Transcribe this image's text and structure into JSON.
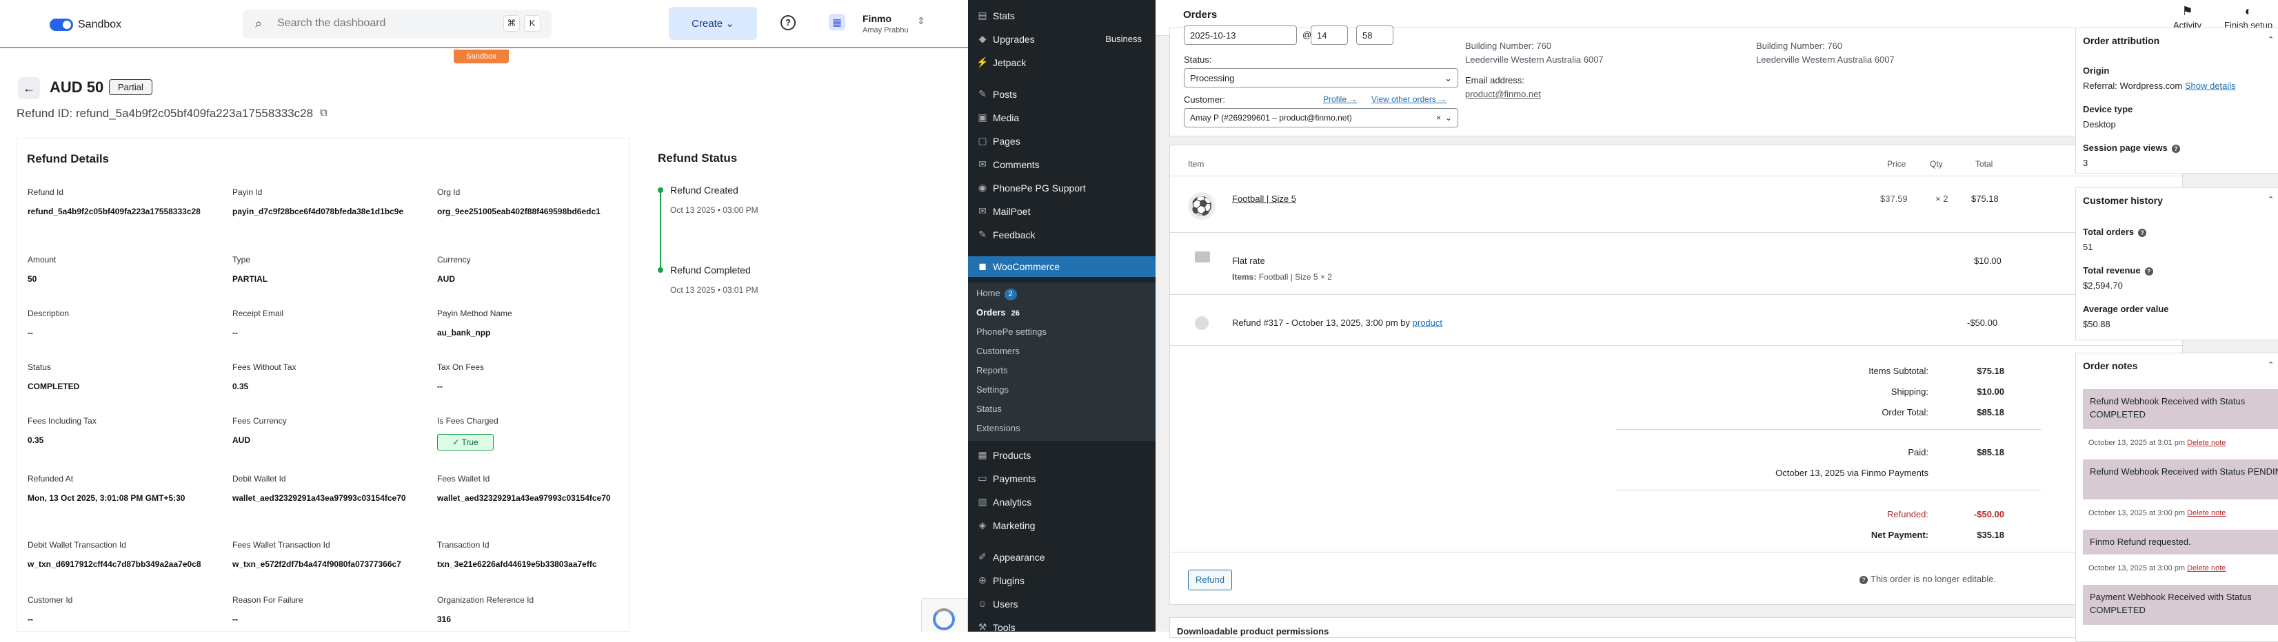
{
  "dashboard": {
    "sandbox_label": "Sandbox",
    "search_placeholder": "Search the dashboard",
    "kbd1": "⌘",
    "kbd2": "K",
    "create_label": "Create",
    "org_name": "Finmo",
    "org_user": "Amay Prabhu",
    "sandbox_tag": "Sandbox",
    "amount": "AUD 50",
    "amount_badge": "Partial",
    "refund_id_line": "Refund ID: refund_5a4b9f2c05bf409fa223a17558333c28",
    "details": {
      "title": "Refund Details",
      "fields": [
        {
          "label": "Refund Id",
          "value": "refund_5a4b9f2c05bf409fa223a17558333c28"
        },
        {
          "label": "Payin Id",
          "value": "payin_d7c9f28bce6f4d078bfeda38e1d1bc9e"
        },
        {
          "label": "Org Id",
          "value": "org_9ee251005eab402f88f469598bd6edc1"
        },
        {
          "label": "Amount",
          "value": "50"
        },
        {
          "label": "Type",
          "value": "PARTIAL"
        },
        {
          "label": "Currency",
          "value": "AUD"
        },
        {
          "label": "Description",
          "value": "--"
        },
        {
          "label": "Receipt Email",
          "value": "--"
        },
        {
          "label": "Payin Method Name",
          "value": "au_bank_npp"
        },
        {
          "label": "Status",
          "value": "COMPLETED"
        },
        {
          "label": "Fees Without Tax",
          "value": "0.35"
        },
        {
          "label": "Tax On Fees",
          "value": "--"
        },
        {
          "label": "Fees Including Tax",
          "value": "0.35"
        },
        {
          "label": "Fees Currency",
          "value": "AUD"
        },
        {
          "label": "Is Fees Charged",
          "value": "True"
        },
        {
          "label": "Refunded At",
          "value": "Mon, 13 Oct 2025, 3:01:08 PM GMT+5:30"
        },
        {
          "label": "Debit Wallet Id",
          "value": "wallet_aed32329291a43ea97993c03154fce70"
        },
        {
          "label": "Fees Wallet Id",
          "value": "wallet_aed32329291a43ea97993c03154fce70"
        },
        {
          "label": "Debit Wallet Transaction Id",
          "value": "w_txn_d6917912cff44c7d87bb349a2aa7e0c8"
        },
        {
          "label": "Fees Wallet Transaction Id",
          "value": "w_txn_e572f2df7b4a474f9080fa07377366c7"
        },
        {
          "label": "Transaction Id",
          "value": "txn_3e21e6226afd44619e5b33803aa7effc"
        },
        {
          "label": "Customer Id",
          "value": "--"
        },
        {
          "label": "Reason For Failure",
          "value": "--"
        },
        {
          "label": "Organization Reference Id",
          "value": "316"
        }
      ]
    },
    "status": {
      "title": "Refund Status",
      "events": [
        {
          "title": "Refund Created",
          "time": "Oct 13 2025 • 03:00 PM"
        },
        {
          "title": "Refund Completed",
          "time": "Oct 13 2025 • 03:01 PM"
        }
      ]
    }
  },
  "wp": {
    "menu": [
      {
        "label": "Stats",
        "icon": "chart-icon"
      },
      {
        "label": "Upgrades",
        "icon": "upgrade-icon",
        "extra": "Business"
      },
      {
        "label": "Jetpack",
        "icon": "jetpack-icon"
      },
      {
        "label": "Posts",
        "icon": "pin-icon"
      },
      {
        "label": "Media",
        "icon": "media-icon"
      },
      {
        "label": "Pages",
        "icon": "pages-icon"
      },
      {
        "label": "Comments",
        "icon": "comments-icon"
      },
      {
        "label": "PhonePe PG Support",
        "icon": "support-icon"
      },
      {
        "label": "MailPoet",
        "icon": "mail-icon"
      },
      {
        "label": "Feedback",
        "icon": "feedback-icon"
      },
      {
        "label": "WooCommerce",
        "icon": "woo-icon"
      },
      {
        "label": "Products",
        "icon": "products-icon"
      },
      {
        "label": "Payments",
        "icon": "payments-icon"
      },
      {
        "label": "Analytics",
        "icon": "analytics-icon"
      },
      {
        "label": "Marketing",
        "icon": "marketing-icon"
      },
      {
        "label": "Appearance",
        "icon": "appearance-icon"
      },
      {
        "label": "Plugins",
        "icon": "plugins-icon"
      },
      {
        "label": "Users",
        "icon": "users-icon"
      },
      {
        "label": "Tools",
        "icon": "tools-icon"
      }
    ],
    "submenu": {
      "home": "Home",
      "home_count": "2",
      "orders": "Orders",
      "orders_count": "26",
      "phonepe": "PhonePe settings",
      "customers": "Customers",
      "reports": "Reports",
      "settings": "Settings",
      "status": "Status",
      "extensions": "Extensions"
    },
    "header": {
      "title": "Orders",
      "activity": "Activity",
      "finish": "Finish setup"
    },
    "order": {
      "date": "2025-10-13",
      "at": "@",
      "hour": "14",
      "minute": "58",
      "status_label": "Status:",
      "status_value": "Processing",
      "customer_label": "Customer:",
      "profile_link": "Profile →",
      "other_orders_link": "View other orders →",
      "customer_value": "Amay P (#269299601 – product@finmo.net)",
      "billing": {
        "line1": "Building Number: 760",
        "line2": "Leederville Western Australia 6007",
        "email_label": "Email address:",
        "email": "product@finmo.net"
      },
      "shipping": {
        "line1": "Building Number: 760",
        "line2": "Leederville Western Australia 6007"
      }
    },
    "items": {
      "head_item": "Item",
      "head_price": "Price",
      "head_qty": "Qty",
      "head_total": "Total",
      "product_name": "Football | Size 5",
      "product_price": "$37.59",
      "product_qty": "× 2",
      "product_total": "$75.18",
      "shipping_name": "Flat rate",
      "shipping_items_label": "Items:",
      "shipping_items": "Football | Size 5 × 2",
      "shipping_total": "$10.00",
      "refund_line": "Refund #317 - October 13, 2025, 3:00 pm by",
      "refund_by": "product",
      "refund_total": "-$50.00"
    },
    "totals": {
      "subtotal_label": "Items Subtotal:",
      "subtotal": "$75.18",
      "shipping_label": "Shipping:",
      "shipping": "$10.00",
      "order_total_label": "Order Total:",
      "order_total": "$85.18",
      "paid_label": "Paid:",
      "paid": "$85.18",
      "paid_note": "October 13, 2025 via Finmo Payments",
      "refunded_label": "Refunded:",
      "refunded": "-$50.00",
      "net_label": "Net Payment:",
      "net": "$35.18"
    },
    "refund_button": "Refund",
    "not_editable": "This order is no longer editable.",
    "downloadable": "Downloadable product permissions",
    "attribution": {
      "title": "Order attribution",
      "origin_label": "Origin",
      "origin_value": "Referral: Wordpress.com",
      "show_details": "Show details",
      "device_label": "Device type",
      "device_value": "Desktop",
      "views_label": "Session page views",
      "views_value": "3"
    },
    "history": {
      "title": "Customer history",
      "total_orders_label": "Total orders",
      "total_orders": "51",
      "revenue_label": "Total revenue",
      "revenue": "$2,594.70",
      "aov_label": "Average order value",
      "aov": "$50.88"
    },
    "notes": {
      "title": "Order notes",
      "delete": "Delete note",
      "items": [
        {
          "text": "Refund Webhook Received with Status COMPLETED",
          "meta": "October 13, 2025 at 3:01 pm"
        },
        {
          "text": "Refund Webhook Received with Status PENDING",
          "meta": "October 13, 2025 at 3:00 pm"
        },
        {
          "text": "Finmo Refund requested.",
          "meta": "October 13, 2025 at 3:00 pm"
        },
        {
          "text": "Payment Webhook Received with Status COMPLETED",
          "meta": ""
        }
      ]
    }
  }
}
